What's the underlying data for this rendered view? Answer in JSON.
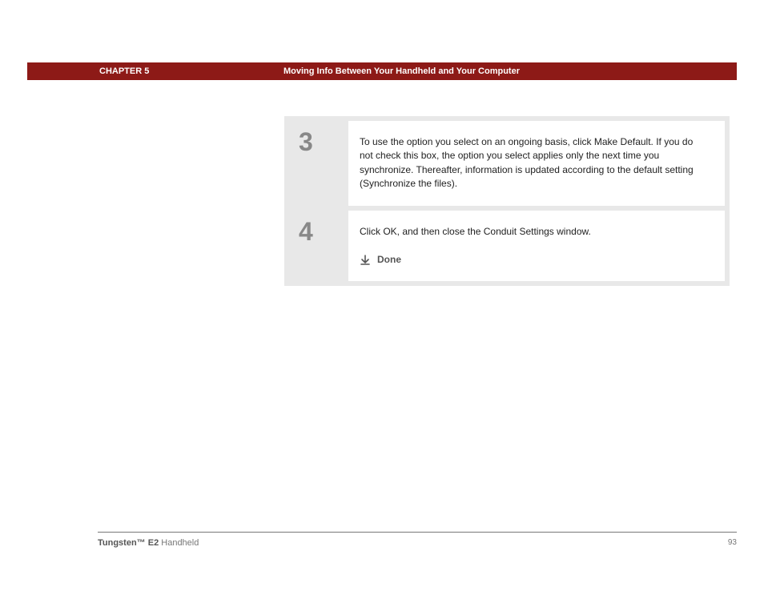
{
  "header": {
    "chapter": "CHAPTER 5",
    "title": "Moving Info Between Your Handheld and Your Computer"
  },
  "steps": [
    {
      "num": "3",
      "text": "To use the option you select on an ongoing basis, click Make Default. If you do not check this box, the option you select applies only the next time you synchronize. Thereafter, information is updated according to the default setting (Synchronize the files)."
    },
    {
      "num": "4",
      "text": "Click OK, and then close the Conduit Settings window.",
      "done": "Done"
    }
  ],
  "footer": {
    "product_bold": "Tungsten™ E2",
    "product_rest": " Handheld",
    "page": "93"
  }
}
